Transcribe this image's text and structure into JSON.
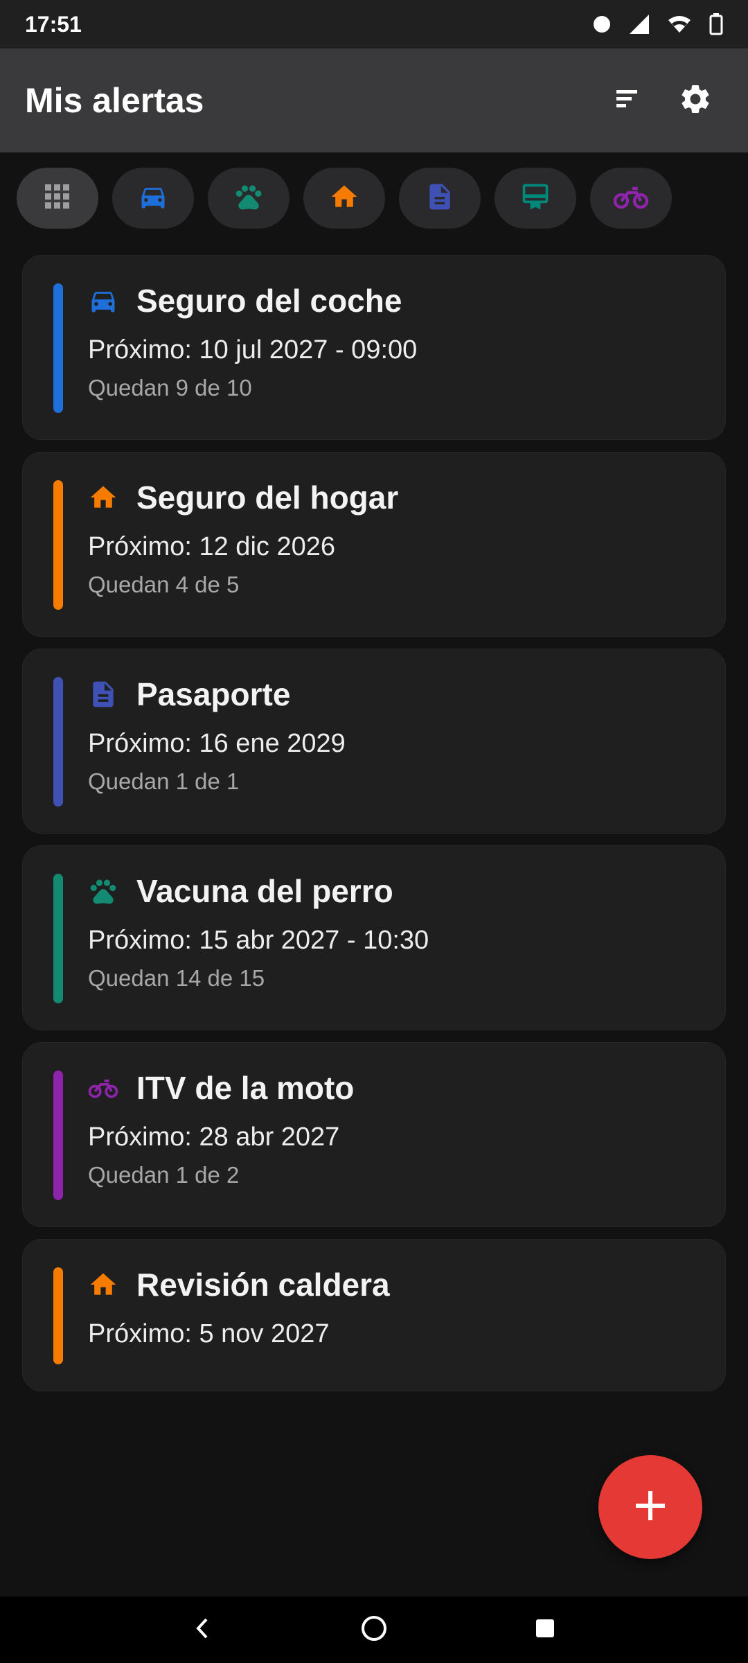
{
  "status_bar": {
    "time": "17:51",
    "icons": [
      "dot-icon",
      "signal-icon",
      "wifi-icon",
      "battery-icon"
    ]
  },
  "app_bar": {
    "title": "Mis alertas",
    "actions": [
      "sort-icon",
      "settings-gear-icon"
    ]
  },
  "filters": [
    {
      "icon": "grid-all-icon",
      "color": "#9e9e9e",
      "selected": true
    },
    {
      "icon": "car-icon",
      "color": "#1e6fd9"
    },
    {
      "icon": "paw-icon",
      "color": "#138a72"
    },
    {
      "icon": "home-icon",
      "color": "#f57c00"
    },
    {
      "icon": "document-icon",
      "color": "#3f51b5"
    },
    {
      "icon": "card-icon",
      "color": "#00897b"
    },
    {
      "icon": "motorcycle-icon",
      "color": "#8e24aa"
    }
  ],
  "alerts": [
    {
      "title": "Seguro del coche",
      "next": "Próximo: 10 jul 2027 - 09:00",
      "remaining": "Quedan 9 de 10",
      "icon": "car-icon",
      "color": "#1e6fd9"
    },
    {
      "title": "Seguro del hogar",
      "next": "Próximo: 12 dic 2026",
      "remaining": "Quedan 4 de 5",
      "icon": "home-icon",
      "color": "#f57c00"
    },
    {
      "title": "Pasaporte",
      "next": "Próximo: 16 ene 2029",
      "remaining": "Quedan 1 de 1",
      "icon": "document-icon",
      "color": "#3f51b5"
    },
    {
      "title": "Vacuna del perro",
      "next": "Próximo: 15 abr 2027 - 10:30",
      "remaining": "Quedan 14 de 15",
      "icon": "paw-icon",
      "color": "#138a72"
    },
    {
      "title": "ITV de la moto",
      "next": "Próximo: 28 abr 2027",
      "remaining": "Quedan 1 de 2",
      "icon": "motorcycle-icon",
      "color": "#8e24aa"
    },
    {
      "title": "Revisión caldera",
      "next": "Próximo: 5 nov 2027",
      "remaining": "",
      "icon": "home-icon",
      "color": "#f57c00"
    }
  ],
  "fab": {
    "icon": "add-icon",
    "color": "#e53935"
  },
  "nav_bar": {
    "icons": [
      "back-icon",
      "home-circle-icon",
      "recents-icon"
    ]
  }
}
